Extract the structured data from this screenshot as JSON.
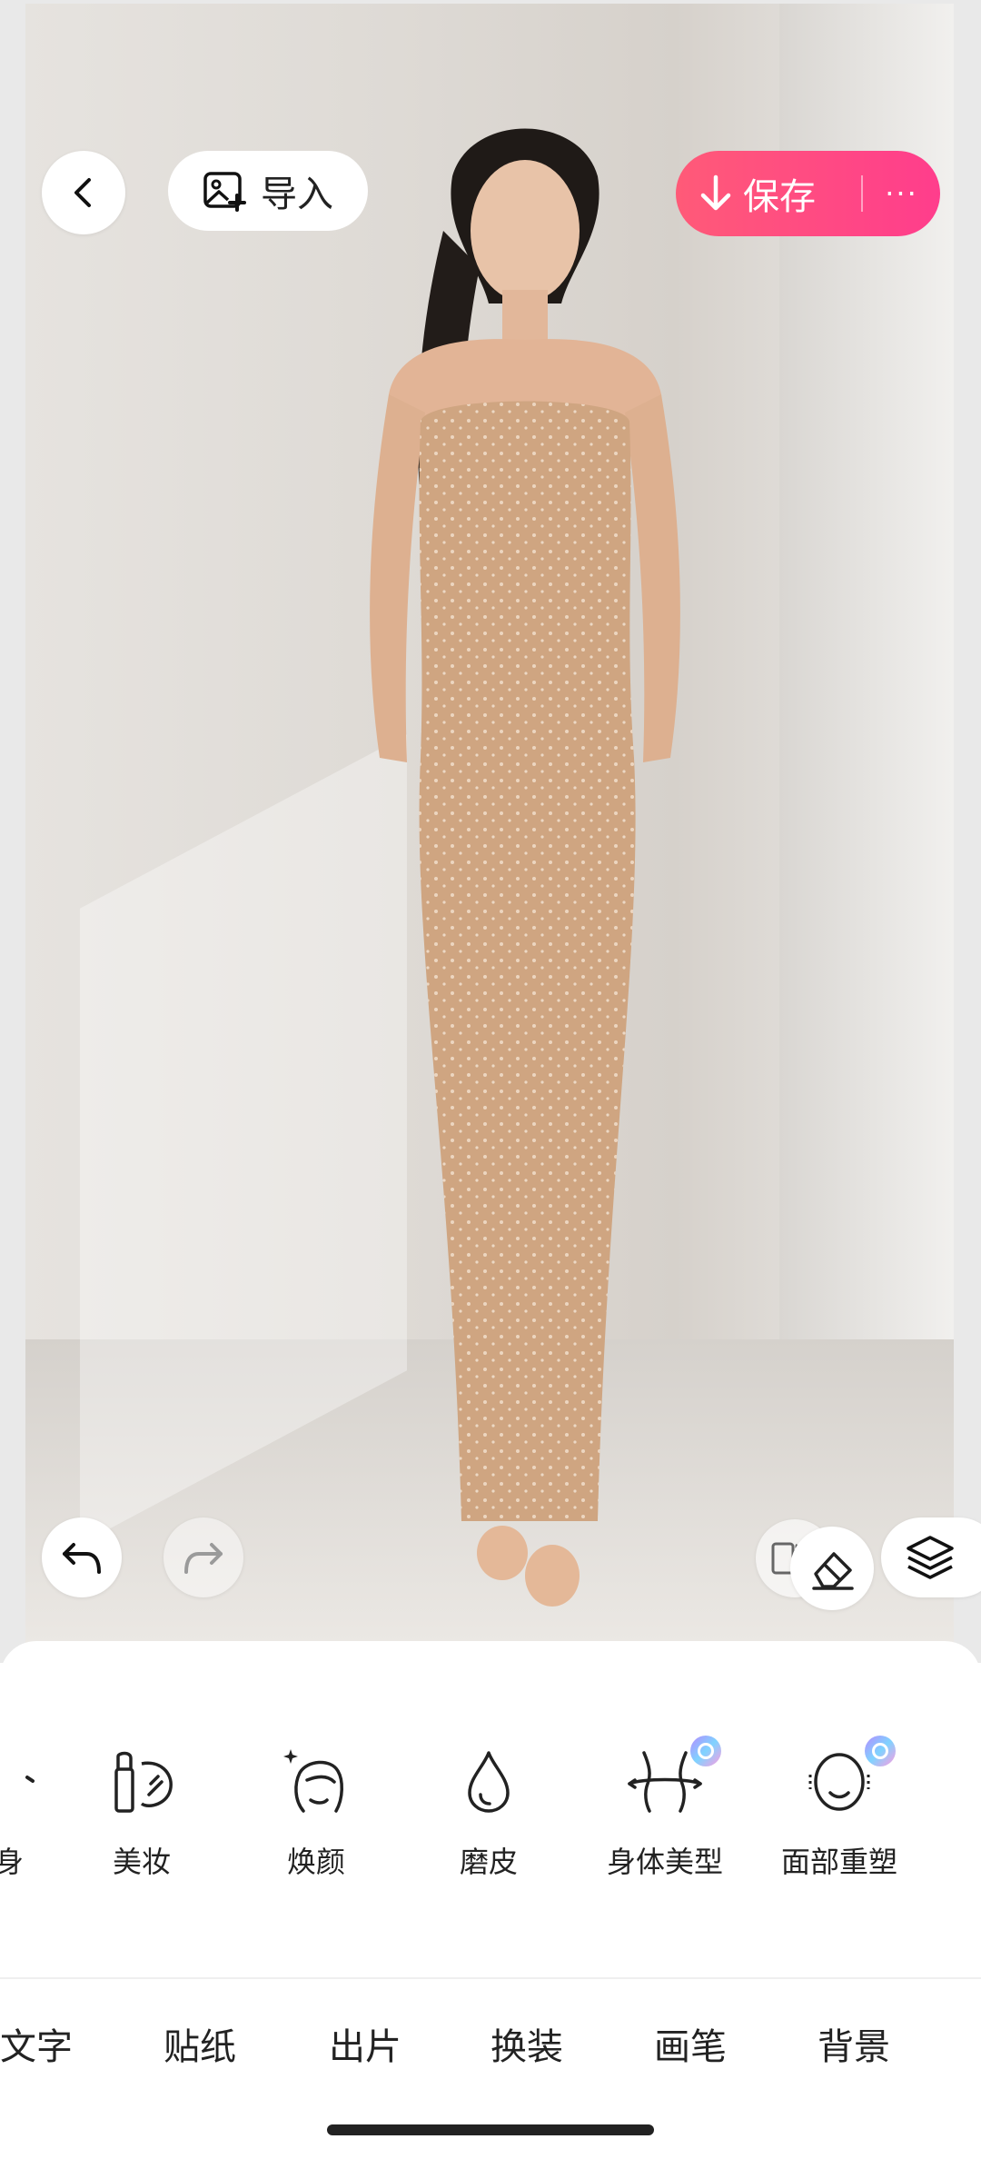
{
  "header": {
    "import_label": "导入",
    "save_label": "保存",
    "more_label": "···"
  },
  "tools": [
    {
      "label": "身",
      "icon": "body-icon"
    },
    {
      "label": "美妆",
      "icon": "makeup-icon"
    },
    {
      "label": "焕颜",
      "icon": "face-refresh-icon"
    },
    {
      "label": "磨皮",
      "icon": "smooth-skin-icon"
    },
    {
      "label": "身体美型",
      "icon": "body-shape-icon",
      "badge": "vip-badge-icon"
    },
    {
      "label": "面部重塑",
      "icon": "face-reshape-icon",
      "badge": "vip-badge-icon"
    }
  ],
  "tabs": [
    {
      "label": "文字"
    },
    {
      "label": "贴纸"
    },
    {
      "label": "出片"
    },
    {
      "label": "换装"
    },
    {
      "label": "画笔"
    },
    {
      "label": "背景"
    }
  ],
  "colors": {
    "accent_start": "#ff5a78",
    "accent_end": "#ff3d8c",
    "panel_bg": "#ffffff"
  }
}
